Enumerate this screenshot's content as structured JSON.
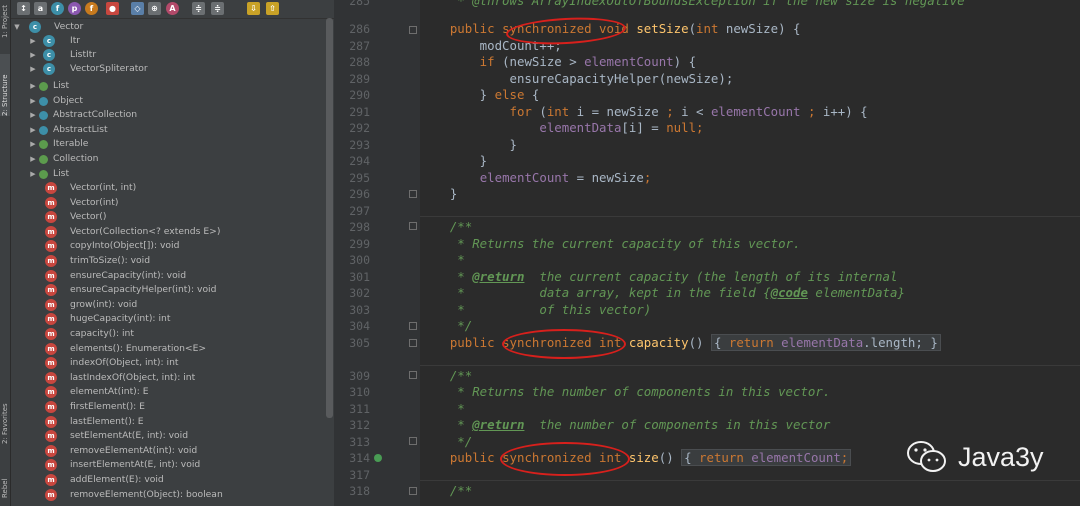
{
  "toolstrip": {
    "tabs": [
      "1: Project",
      "2: Structure",
      "2: Favorites",
      "Rebel"
    ]
  },
  "structure": {
    "toolbar_icons": [
      "sort-by-type-icon",
      "sort-alpha-icon",
      "show-fields-icon",
      "show-properties-icon",
      "show-inherited-icon",
      "show-anonymous-icon",
      "show-lambdas-icon",
      "autoscroll-icon",
      "expand-all-icon",
      "collapse-all-icon",
      "autoscroll-to-source-icon",
      "autoscroll-from-source-icon"
    ],
    "root": "Vector",
    "nested": [
      "Itr",
      "ListItr",
      "VectorSpliterator"
    ],
    "supers": [
      "List",
      "Object",
      "AbstractCollection",
      "AbstractList",
      "Iterable",
      "Collection",
      "List"
    ],
    "methods": [
      "Vector(int, int)",
      "Vector(int)",
      "Vector()",
      "Vector(Collection<? extends E>)",
      "copyInto(Object[]): void",
      "trimToSize(): void",
      "ensureCapacity(int): void",
      "ensureCapacityHelper(int): void",
      "grow(int): void",
      "hugeCapacity(int): int",
      "capacity(): int",
      "elements(): Enumeration<E>",
      "indexOf(Object, int): int",
      "lastIndexOf(Object, int): int",
      "elementAt(int): E",
      "firstElement(): E",
      "lastElement(): E",
      "setElementAt(E, int): void",
      "removeElementAt(int): void",
      "insertElementAt(E, int): void",
      "addElement(E): void",
      "removeElement(Object): boolean"
    ]
  },
  "editor": {
    "line_numbers": [
      "285",
      "286",
      "287",
      "288",
      "289",
      "290",
      "291",
      "292",
      "293",
      "294",
      "295",
      "296",
      "297",
      "298",
      "299",
      "300",
      "301",
      "302",
      "303",
      "304",
      "305",
      "309",
      "310",
      "311",
      "312",
      "313",
      "314",
      "317",
      "318"
    ],
    "code": {
      "l285": "     * @throws ArrayIndexOutOfBoundsException if the new size is negative",
      "l286a": "    public ",
      "l286b": "synchronized void ",
      "l286c": "setSize",
      "l286d": "(",
      "l286e": "int ",
      "l286f": "newSize) {",
      "l287": "        modCount++;",
      "l288a": "        if ",
      "l288b": "(newSize > ",
      "l288c": "elementCount",
      "l288d": ") {",
      "l289": "            ensureCapacityHelper(newSize);",
      "l290a": "        } ",
      "l290b": "else ",
      "l290c": "{",
      "l291a": "            for ",
      "l291b": "(",
      "l291c": "int ",
      "l291d": "i = newSize ",
      "l291e": "; ",
      "l291f": "i < ",
      "l291g": "elementCount ",
      "l291h": "; ",
      "l291i": "i++) {",
      "l292a": "                ",
      "l292b": "elementData",
      "l292c": "[i] = ",
      "l292d": "null",
      "l292e": ";",
      "l293": "            }",
      "l294": "        }",
      "l295a": "        ",
      "l295b": "elementCount ",
      "l295c": "= newSize",
      "l295d": ";",
      "l296": "    }",
      "l298": "    /**",
      "l299": "     * Returns the current capacity of this vector.",
      "l300": "     *",
      "l301a": "     * ",
      "l301b": "@return",
      "l301c": "  the current capacity (the length of its internal",
      "l302a": "     *          data array, kept in the field {",
      "l302b": "@code",
      "l302c": " elementData}",
      "l303": "     *          of this vector)",
      "l304": "     */",
      "l305a": "    public ",
      "l305b": "synchronized int ",
      "l305c": "capacity",
      "l305d": "() ",
      "l305e": "{ ",
      "l305f": "return ",
      "l305g": "elementData",
      "l305h": ".length; ",
      "l305i": "}",
      "l309": "    /**",
      "l310": "     * Returns the number of components in this vector.",
      "l311": "     *",
      "l312a": "     * ",
      "l312b": "@return",
      "l312c": "  the number of components in this vector",
      "l313": "     */",
      "l314a": "    public ",
      "l314b": "synchronized int ",
      "l314c": "size",
      "l314d": "() ",
      "l314e": "{ ",
      "l314f": "return ",
      "l314g": "elementCount",
      "l314h": ";",
      "l318": "    /**"
    }
  },
  "watermark": {
    "text": "Java3y",
    "icon": "wechat-icon"
  },
  "colors": {
    "keyword": "#cc7832",
    "method": "#ffc66d",
    "field": "#9876aa",
    "comment": "#629755",
    "text": "#a9b7c6",
    "highlight_ellipse": "#d8201c"
  }
}
